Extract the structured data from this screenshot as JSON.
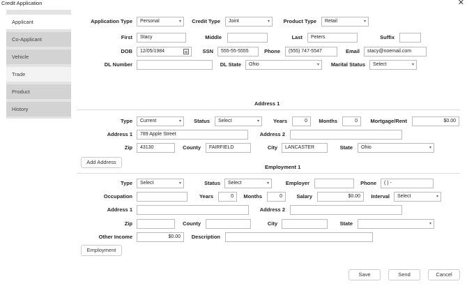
{
  "window": {
    "title": "Credit Application",
    "close_glyph": "✕"
  },
  "sidebar": {
    "tabs": [
      {
        "label": "Applicant"
      },
      {
        "label": "Co-Applicant"
      },
      {
        "label": "Vehicle"
      },
      {
        "label": "Trade"
      },
      {
        "label": "Product"
      },
      {
        "label": "History"
      }
    ]
  },
  "application": {
    "application_type_label": "Application Type",
    "application_type_value": "Personal",
    "credit_type_label": "Credit Type",
    "credit_type_value": "Joint",
    "product_type_label": "Product Type",
    "product_type_value": "Retail"
  },
  "applicant": {
    "first_label": "First",
    "first_value": "Stacy",
    "middle_label": "Middle",
    "middle_value": "",
    "last_label": "Last",
    "last_value": "Peters",
    "suffix_label": "Suffix",
    "suffix_value": "",
    "dob_label": "DOB",
    "dob_value": "12/05/1984",
    "ssn_label": "SSN",
    "ssn_value": "555-55-5555",
    "phone_label": "Phone",
    "phone_value": "(555) 747-5547",
    "email_label": "Email",
    "email_value": "stacy@noemail.com",
    "dl_number_label": "DL Number",
    "dl_number_value": "",
    "dl_state_label": "DL State",
    "dl_state_value": "Ohio",
    "marital_status_label": "Marital Status",
    "marital_status_value": "Select"
  },
  "address": {
    "heading": "Address 1",
    "type_label": "Type",
    "type_value": "Current",
    "status_label": "Status",
    "status_value": "Select",
    "years_label": "Years",
    "years_value": "0",
    "months_label": "Months",
    "months_value": "0",
    "mortgage_label": "Mortgage/Rent",
    "mortgage_value": "$0.00",
    "address1_label": "Address 1",
    "address1_value": "789 Apple Street",
    "address2_label": "Address 2",
    "address2_value": "",
    "zip_label": "Zip",
    "zip_value": "43130",
    "county_label": "County",
    "county_value": "FAIRFIELD",
    "city_label": "City",
    "city_value": "LANCASTER",
    "state_label": "State",
    "state_value": "Ohio",
    "add_button": "Add Address"
  },
  "employment": {
    "heading": "Employment 1",
    "type_label": "Type",
    "type_value": "Select",
    "status_label": "Status",
    "status_value": "Select",
    "employer_label": "Employer",
    "employer_value": "",
    "phone_label": "Phone",
    "phone_value": "(  )  -",
    "occupation_label": "Occupation",
    "occupation_value": "",
    "years_label": "Years",
    "years_value": "0",
    "months_label": "Months",
    "months_value": "0",
    "salary_label": "Salary",
    "salary_value": "$0.00",
    "interval_label": "Interval",
    "interval_value": "Select",
    "address1_label": "Address 1",
    "address1_value": "",
    "address2_label": "Address 2",
    "address2_value": "",
    "zip_label": "Zip",
    "zip_value": "",
    "county_label": "County",
    "county_value": "",
    "city_label": "City",
    "city_value": "",
    "state_label": "State",
    "state_value": "",
    "other_income_label": "Other Income",
    "other_income_value": "$0.00",
    "description_label": "Description",
    "description_value": "",
    "employment_button": "Employment"
  },
  "footer": {
    "save": "Save",
    "send": "Send",
    "cancel": "Cancel"
  },
  "icons": {
    "caret": "▾"
  }
}
